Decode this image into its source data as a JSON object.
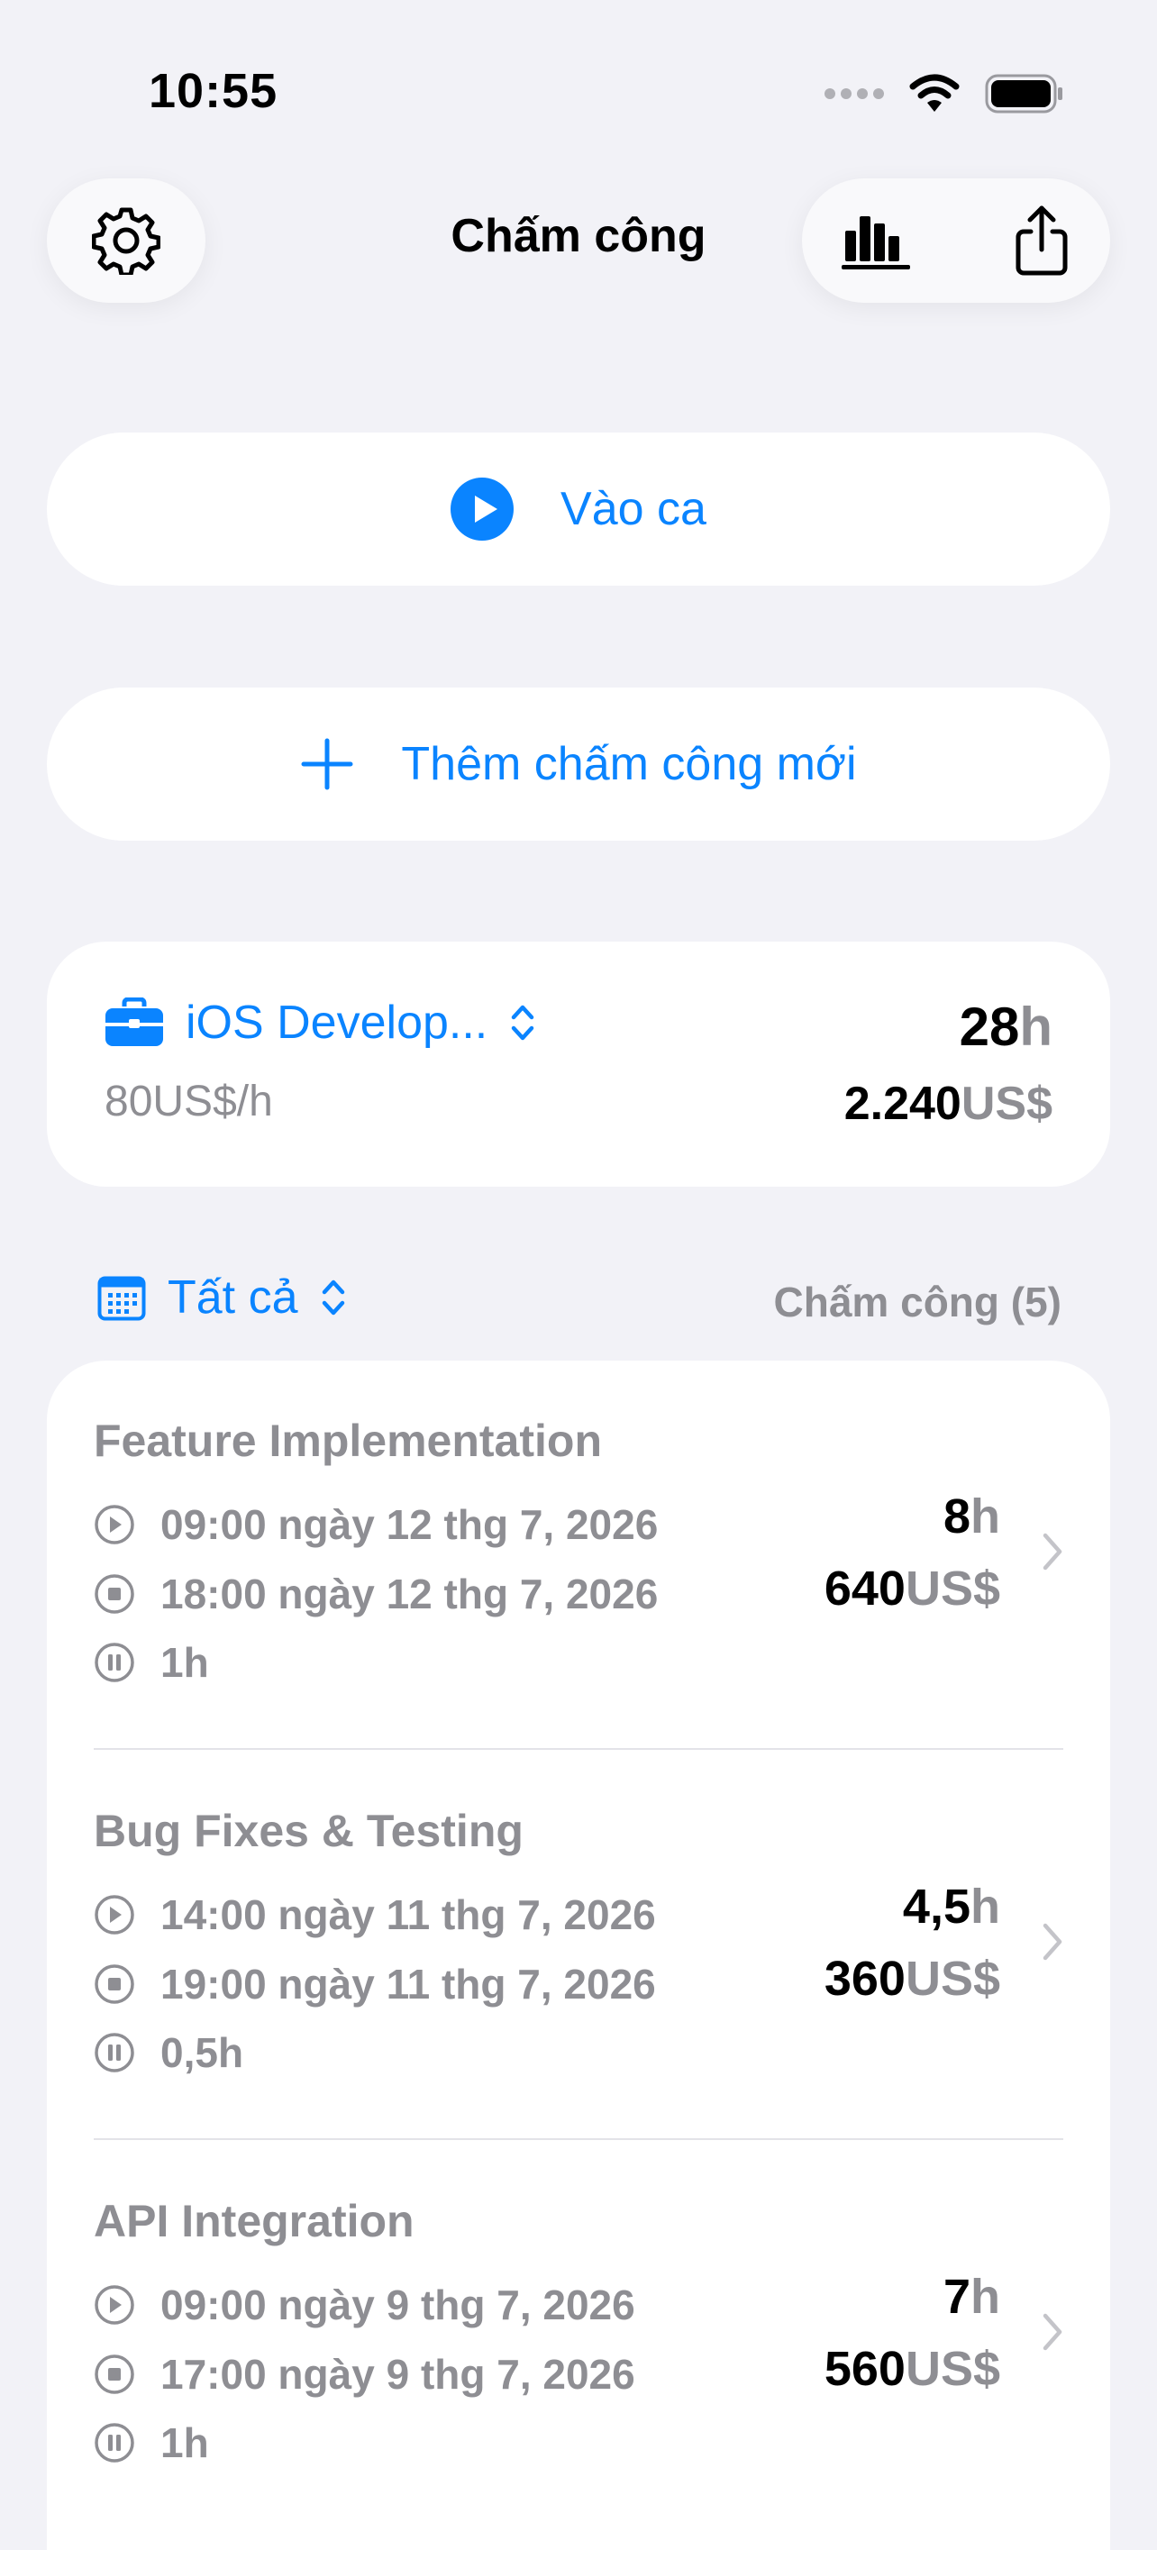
{
  "status_bar": {
    "time": "10:55"
  },
  "nav": {
    "title": "Chấm công"
  },
  "actions": {
    "clock_in_label": "Vào ca",
    "add_new_label": "Thêm chấm công mới"
  },
  "job": {
    "name": "iOS Develop...",
    "rate": "80US$/h",
    "hours_value": "28",
    "hours_unit": "h",
    "total_value": "2.240",
    "total_unit": "US$"
  },
  "filter": {
    "label": "Tất cả",
    "count_label": "Chấm công (5)"
  },
  "entries": [
    {
      "title": "Feature Implementation",
      "start": "09:00 ngày 12 thg 7, 2026",
      "end": "18:00 ngày 12 thg 7, 2026",
      "break": "1h",
      "hours_value": "8",
      "hours_unit": "h",
      "amount_value": "640",
      "amount_unit": "US$"
    },
    {
      "title": "Bug Fixes & Testing",
      "start": "14:00 ngày 11 thg 7, 2026",
      "end": "19:00 ngày 11 thg 7, 2026",
      "break": "0,5h",
      "hours_value": "4,5",
      "hours_unit": "h",
      "amount_value": "360",
      "amount_unit": "US$"
    },
    {
      "title": "API Integration",
      "start": "09:00 ngày 9 thg 7, 2026",
      "end": "17:00 ngày 9 thg 7, 2026",
      "break": "1h",
      "hours_value": "7",
      "hours_unit": "h",
      "amount_value": "560",
      "amount_unit": "US$"
    }
  ],
  "colors": {
    "accent": "#0a84ff",
    "background": "#f2f2f7",
    "secondary_text": "#8e8e93"
  }
}
